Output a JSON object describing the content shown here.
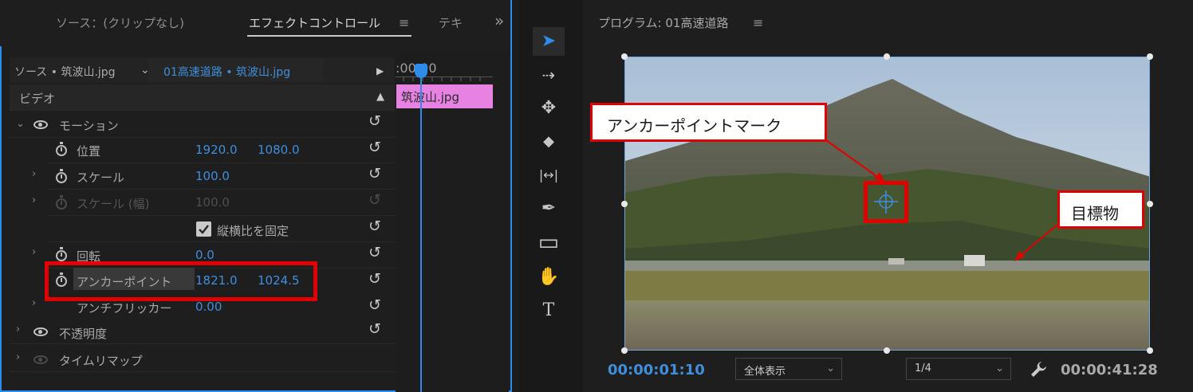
{
  "left_panel": {
    "tabs": [
      {
        "label": "ソース：(クリップなし)"
      },
      {
        "label": "エフェクトコントロール"
      },
      {
        "label": "テキ"
      }
    ],
    "tabs_menu": "≡",
    "overflow": "»",
    "source_label": "ソース • 筑波山.jpg",
    "clip_label": "01高速道路 • 筑波山.jpg",
    "timeline": {
      "time": ":00:00",
      "clip_name": "筑波山.jpg"
    },
    "section_video": "ビデオ",
    "rows": {
      "motion": {
        "label": "モーション"
      },
      "position": {
        "label": "位置",
        "x": "1920.0",
        "y": "1080.0"
      },
      "scale": {
        "label": "スケール",
        "value": "100.0"
      },
      "scale_width": {
        "label": "スケール (幅)",
        "value": "100.0"
      },
      "uniform": {
        "label": "縦横比を固定",
        "checked": true
      },
      "rotation": {
        "label": "回転",
        "value": "0.0"
      },
      "anchor": {
        "label": "アンカーポイント",
        "x": "1821.0",
        "y": "1024.5"
      },
      "antiflicker": {
        "label": "アンチフリッカー",
        "value": "0.00"
      },
      "opacity": {
        "label": "不透明度"
      },
      "time_remap": {
        "label": "タイムリマップ"
      }
    },
    "reset_glyph": "↺"
  },
  "tools": [
    {
      "icon": "selection-tool-icon",
      "glyph": "➤"
    },
    {
      "icon": "track-select-forward-icon",
      "glyph": "⇢"
    },
    {
      "icon": "ripple-edit-icon",
      "glyph": "✥"
    },
    {
      "icon": "razor-icon",
      "glyph": "◆"
    },
    {
      "icon": "slip-tool-icon",
      "glyph": "|↔|"
    },
    {
      "icon": "pen-tool-icon",
      "glyph": "✒"
    },
    {
      "icon": "rectangle-tool-icon",
      "glyph": "▭"
    },
    {
      "icon": "hand-tool-icon",
      "glyph": "✋"
    },
    {
      "icon": "type-tool-icon",
      "glyph": "T"
    }
  ],
  "program": {
    "title": "プログラム: 01高速道路",
    "menu": "≡",
    "current_time": "00:00:01:10",
    "duration": "00:00:41:28",
    "zoom": "全体表示",
    "resolution": "1/4",
    "callout_anchor": "アンカーポイントマーク",
    "callout_target": "目標物"
  },
  "colors": {
    "accent": "#2d8ceb",
    "value_blue": "#3f8fdc",
    "highlight_red": "#e00000",
    "clip_pink": "#e782e3"
  }
}
